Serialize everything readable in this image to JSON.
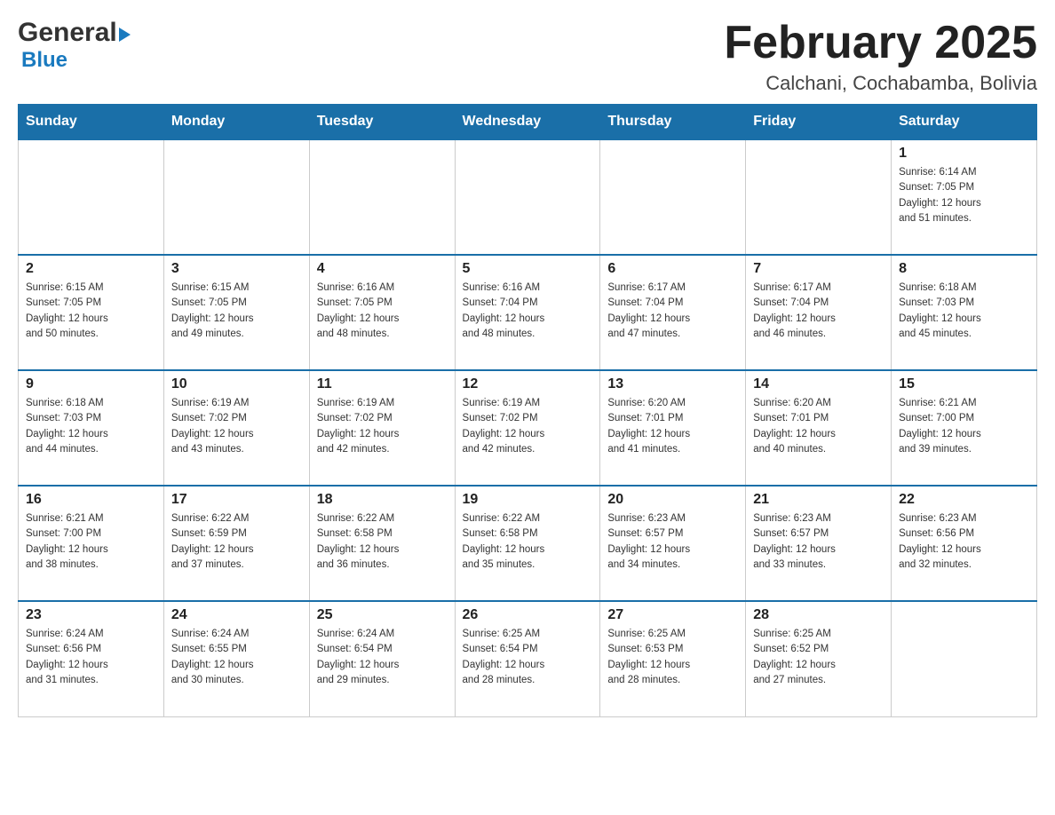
{
  "header": {
    "logo_general": "General",
    "logo_blue": "Blue",
    "month_title": "February 2025",
    "location": "Calchani, Cochabamba, Bolivia"
  },
  "weekdays": [
    "Sunday",
    "Monday",
    "Tuesday",
    "Wednesday",
    "Thursday",
    "Friday",
    "Saturday"
  ],
  "weeks": [
    [
      {
        "day": "",
        "info": ""
      },
      {
        "day": "",
        "info": ""
      },
      {
        "day": "",
        "info": ""
      },
      {
        "day": "",
        "info": ""
      },
      {
        "day": "",
        "info": ""
      },
      {
        "day": "",
        "info": ""
      },
      {
        "day": "1",
        "info": "Sunrise: 6:14 AM\nSunset: 7:05 PM\nDaylight: 12 hours\nand 51 minutes."
      }
    ],
    [
      {
        "day": "2",
        "info": "Sunrise: 6:15 AM\nSunset: 7:05 PM\nDaylight: 12 hours\nand 50 minutes."
      },
      {
        "day": "3",
        "info": "Sunrise: 6:15 AM\nSunset: 7:05 PM\nDaylight: 12 hours\nand 49 minutes."
      },
      {
        "day": "4",
        "info": "Sunrise: 6:16 AM\nSunset: 7:05 PM\nDaylight: 12 hours\nand 48 minutes."
      },
      {
        "day": "5",
        "info": "Sunrise: 6:16 AM\nSunset: 7:04 PM\nDaylight: 12 hours\nand 48 minutes."
      },
      {
        "day": "6",
        "info": "Sunrise: 6:17 AM\nSunset: 7:04 PM\nDaylight: 12 hours\nand 47 minutes."
      },
      {
        "day": "7",
        "info": "Sunrise: 6:17 AM\nSunset: 7:04 PM\nDaylight: 12 hours\nand 46 minutes."
      },
      {
        "day": "8",
        "info": "Sunrise: 6:18 AM\nSunset: 7:03 PM\nDaylight: 12 hours\nand 45 minutes."
      }
    ],
    [
      {
        "day": "9",
        "info": "Sunrise: 6:18 AM\nSunset: 7:03 PM\nDaylight: 12 hours\nand 44 minutes."
      },
      {
        "day": "10",
        "info": "Sunrise: 6:19 AM\nSunset: 7:02 PM\nDaylight: 12 hours\nand 43 minutes."
      },
      {
        "day": "11",
        "info": "Sunrise: 6:19 AM\nSunset: 7:02 PM\nDaylight: 12 hours\nand 42 minutes."
      },
      {
        "day": "12",
        "info": "Sunrise: 6:19 AM\nSunset: 7:02 PM\nDaylight: 12 hours\nand 42 minutes."
      },
      {
        "day": "13",
        "info": "Sunrise: 6:20 AM\nSunset: 7:01 PM\nDaylight: 12 hours\nand 41 minutes."
      },
      {
        "day": "14",
        "info": "Sunrise: 6:20 AM\nSunset: 7:01 PM\nDaylight: 12 hours\nand 40 minutes."
      },
      {
        "day": "15",
        "info": "Sunrise: 6:21 AM\nSunset: 7:00 PM\nDaylight: 12 hours\nand 39 minutes."
      }
    ],
    [
      {
        "day": "16",
        "info": "Sunrise: 6:21 AM\nSunset: 7:00 PM\nDaylight: 12 hours\nand 38 minutes."
      },
      {
        "day": "17",
        "info": "Sunrise: 6:22 AM\nSunset: 6:59 PM\nDaylight: 12 hours\nand 37 minutes."
      },
      {
        "day": "18",
        "info": "Sunrise: 6:22 AM\nSunset: 6:58 PM\nDaylight: 12 hours\nand 36 minutes."
      },
      {
        "day": "19",
        "info": "Sunrise: 6:22 AM\nSunset: 6:58 PM\nDaylight: 12 hours\nand 35 minutes."
      },
      {
        "day": "20",
        "info": "Sunrise: 6:23 AM\nSunset: 6:57 PM\nDaylight: 12 hours\nand 34 minutes."
      },
      {
        "day": "21",
        "info": "Sunrise: 6:23 AM\nSunset: 6:57 PM\nDaylight: 12 hours\nand 33 minutes."
      },
      {
        "day": "22",
        "info": "Sunrise: 6:23 AM\nSunset: 6:56 PM\nDaylight: 12 hours\nand 32 minutes."
      }
    ],
    [
      {
        "day": "23",
        "info": "Sunrise: 6:24 AM\nSunset: 6:56 PM\nDaylight: 12 hours\nand 31 minutes."
      },
      {
        "day": "24",
        "info": "Sunrise: 6:24 AM\nSunset: 6:55 PM\nDaylight: 12 hours\nand 30 minutes."
      },
      {
        "day": "25",
        "info": "Sunrise: 6:24 AM\nSunset: 6:54 PM\nDaylight: 12 hours\nand 29 minutes."
      },
      {
        "day": "26",
        "info": "Sunrise: 6:25 AM\nSunset: 6:54 PM\nDaylight: 12 hours\nand 28 minutes."
      },
      {
        "day": "27",
        "info": "Sunrise: 6:25 AM\nSunset: 6:53 PM\nDaylight: 12 hours\nand 28 minutes."
      },
      {
        "day": "28",
        "info": "Sunrise: 6:25 AM\nSunset: 6:52 PM\nDaylight: 12 hours\nand 27 minutes."
      },
      {
        "day": "",
        "info": ""
      }
    ]
  ]
}
